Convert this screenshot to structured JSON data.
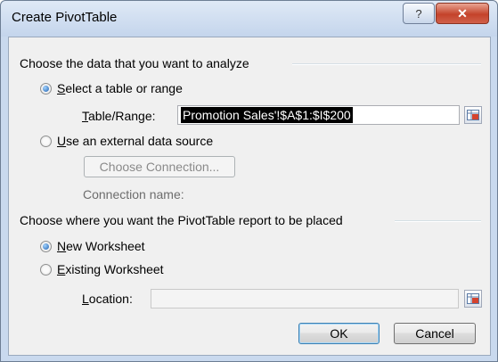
{
  "window": {
    "title": "Create PivotTable",
    "help_icon": "?",
    "close_icon": "✕"
  },
  "data_section": {
    "heading": "Choose the data that you want to analyze",
    "option_table": {
      "prefix": "",
      "accel": "S",
      "rest": "elect a table or range",
      "checked": true
    },
    "table_range": {
      "accel": "T",
      "rest": "able/Range:",
      "value": "Promotion Sales'!$A$1:$I$200"
    },
    "option_external": {
      "accel": "U",
      "rest": "se an external data source",
      "checked": false
    },
    "choose_connection": "Choose Connection...",
    "connection_name": "Connection name:"
  },
  "placement_section": {
    "heading": "Choose where you want the PivotTable report to be placed",
    "option_new": {
      "accel": "N",
      "rest": "ew Worksheet",
      "checked": true
    },
    "option_existing": {
      "accel": "E",
      "rest": "xisting Worksheet",
      "checked": false
    },
    "location": {
      "accel": "L",
      "rest": "ocation:",
      "value": ""
    }
  },
  "buttons": {
    "ok": "OK",
    "cancel": "Cancel"
  }
}
